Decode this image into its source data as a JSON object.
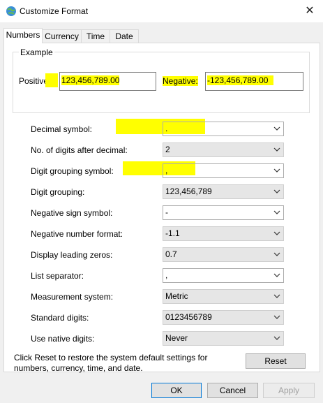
{
  "window": {
    "title": "Customize Format",
    "close_glyph": "✕"
  },
  "tabs": [
    {
      "label": "Numbers",
      "active": true
    },
    {
      "label": "Currency",
      "active": false
    },
    {
      "label": "Time",
      "active": false
    },
    {
      "label": "Date",
      "active": false
    }
  ],
  "example": {
    "legend": "Example",
    "positive_label": "Positive:",
    "positive_value": "123,456,789.00",
    "negative_label": "Negative:",
    "negative_value": "-123,456,789.00"
  },
  "settings": [
    {
      "label": "Decimal symbol:",
      "value": ".",
      "enabled": true
    },
    {
      "label": "No. of digits after decimal:",
      "value": "2",
      "enabled": true
    },
    {
      "label": "Digit grouping symbol:",
      "value": ",",
      "enabled": true
    },
    {
      "label": "Digit grouping:",
      "value": "123,456,789",
      "enabled": true
    },
    {
      "label": "Negative sign symbol:",
      "value": "-",
      "enabled": true
    },
    {
      "label": "Negative number format:",
      "value": "-1.1",
      "enabled": true
    },
    {
      "label": "Display leading zeros:",
      "value": "0.7",
      "enabled": true
    },
    {
      "label": "List separator:",
      "value": ",",
      "enabled": true
    },
    {
      "label": "Measurement system:",
      "value": "Metric",
      "enabled": true
    },
    {
      "label": "Standard digits:",
      "value": "0123456789",
      "enabled": true
    },
    {
      "label": "Use native digits:",
      "value": "Never",
      "enabled": true
    }
  ],
  "reset_note": "Click Reset to restore the system default settings for numbers, currency, time, and date.",
  "buttons": {
    "reset": "Reset",
    "ok": "OK",
    "cancel": "Cancel",
    "apply": "Apply"
  },
  "colors": {
    "highlight": "#ffff00",
    "primary_border": "#0078d7"
  },
  "icons": {
    "app": "globe-icon",
    "dropdown": "chevron-down-icon"
  }
}
